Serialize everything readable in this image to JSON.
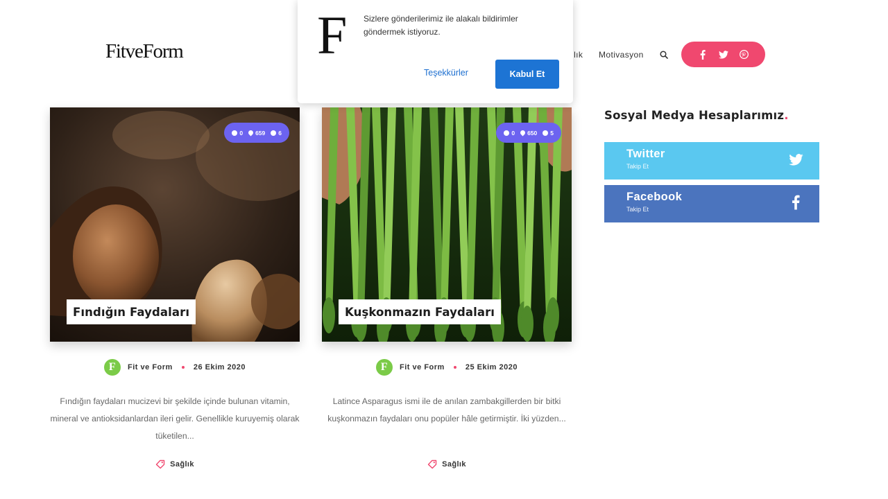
{
  "site": {
    "logo": "FitveForm"
  },
  "nav": {
    "items": [
      {
        "label": "ğlık"
      },
      {
        "label": "Motivasyon"
      }
    ],
    "search_icon": "search-icon",
    "social_icons": [
      "facebook-icon",
      "twitter-icon",
      "pinterest-icon"
    ],
    "social_color": "#f0486f"
  },
  "notification_popup": {
    "logo_letter": "F",
    "message": "Sizlere gönderilerimiz ile alakalı bildirimler göndermek istiyoruz.",
    "decline_label": "Teşekkürler",
    "accept_label": "Kabul Et",
    "accept_color": "#1d74d4"
  },
  "posts": [
    {
      "title": "Fındığın Faydaları",
      "stats": {
        "comments": "0",
        "views": "659",
        "read_minutes": "6"
      },
      "author_initial": "F",
      "author": "Fit ve Form",
      "date": "26 Ekim 2020",
      "excerpt": "Fındığın faydaları mucizevi bir şekilde içinde bulunan vitamin, mineral ve antioksidanlardan ileri gelir. Genellikle kuruyemiş olarak tüketilen...",
      "category": "Sağlık"
    },
    {
      "title": "Kuşkonmazın Faydaları",
      "stats": {
        "comments": "0",
        "views": "650",
        "read_minutes": "5"
      },
      "author_initial": "F",
      "author": "Fit ve Form",
      "date": "25 Ekim 2020",
      "excerpt": "Latince Asparagus ismi ile de anılan zambakgillerden bir bitki kuşkonmazın faydaları onu popüler hâle getirmiştir. İki yüzden...",
      "category": "Sağlık"
    }
  ],
  "sidebar": {
    "title": "Sosyal Medya Hesaplarımız",
    "title_accent": ".",
    "accounts": [
      {
        "name": "Twitter",
        "action": "Takip Et",
        "color": "#5ac8f0",
        "icon": "twitter-icon"
      },
      {
        "name": "Facebook",
        "action": "Takip Et",
        "color": "#4b74be",
        "icon": "facebook-icon"
      }
    ]
  },
  "colors": {
    "accent": "#f0486f",
    "stats_badge": "#6c63f0",
    "author_avatar": "#7bcb48"
  }
}
